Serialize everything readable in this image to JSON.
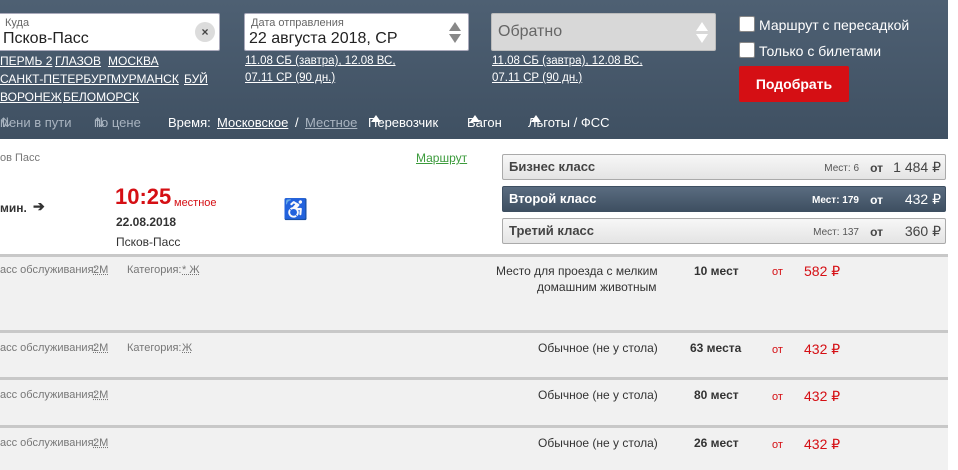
{
  "search": {
    "to_label": "Куда",
    "to_value": "Псков-Пасс",
    "clear_icon": "×",
    "cities": [
      "ПЕРМЬ 2",
      "ГЛАЗОВ",
      "МОСКВА",
      "САНКТ-ПЕТЕРБУРГ",
      "МУРМАНСК",
      "БУЙ",
      "ВОРОНЕЖ",
      "БЕЛОМОРСК"
    ],
    "date_label": "Дата отправления",
    "date_value": "22 августа 2018, СР",
    "date_quick": [
      "11.08 СБ (завтра), 12.08 ВС,",
      "07.11 СР (90 дн.)"
    ],
    "return_placeholder": "Обратно",
    "return_quick": [
      "11.08 СБ (завтра), 12.08 ВС,",
      "07.11 СР (90 дн.)"
    ],
    "transfer_label": "Маршрут с пересадкой",
    "tickets_label": "Только с билетами",
    "submit_label": "Подобрать"
  },
  "sort": {
    "by_time": "мени в пути",
    "by_price": "по цене",
    "time_label": "Время:",
    "moscow": "Московское",
    "slash": "/",
    "local": "Местное",
    "carrier": "Перевозчик",
    "wagon": "Вагон",
    "benefits": "Льготы / ФСС"
  },
  "train": {
    "from_station": "ов Пасс",
    "route_link": "Маршрут",
    "duration": "мин.",
    "arrive_time": "10:25",
    "arrive_kind": "местное",
    "arrive_date": "22.08.2018",
    "arrive_station": "Псков-Пасс"
  },
  "classes": [
    {
      "name": "Бизнес класс",
      "seats": "Мест: 6",
      "ot": "от",
      "price": "1 484 ₽"
    },
    {
      "name": "Второй класс",
      "seats": "Мест: 179",
      "ot": "от",
      "price": "432 ₽"
    },
    {
      "name": "Третий класс",
      "seats": "Мест: 137",
      "ot": "от",
      "price": "360 ₽"
    }
  ],
  "wagons": [
    {
      "service_label": "асс обслуживания:",
      "service": "2М",
      "category_label": "Категория:",
      "category": "* Ж",
      "type": "Место для проезда с мелким домашним животным",
      "type_line1": "Место для проезда с мелким",
      "type_line2": "домашним животным",
      "count": "10 мест",
      "ot": "от",
      "price": "582 ₽"
    },
    {
      "service_label": "асс обслуживания:",
      "service": "2М",
      "category_label": "Категория:",
      "category": "Ж",
      "type": "Обычное (не у стола)",
      "count": "63 места",
      "ot": "от",
      "price": "432 ₽"
    },
    {
      "service_label": "асс обслуживания:",
      "service": "2М",
      "type": "Обычное (не у стола)",
      "count": "80 мест",
      "ot": "от",
      "price": "432 ₽"
    },
    {
      "service_label": "асс обслуживания:",
      "service": "2М",
      "type": "Обычное (не у стола)",
      "count": "26 мест",
      "ot": "от",
      "price": "432 ₽"
    }
  ],
  "colors": {
    "header": "#44566a",
    "accent": "#d50f14",
    "selected_class": "#3e4f61"
  }
}
